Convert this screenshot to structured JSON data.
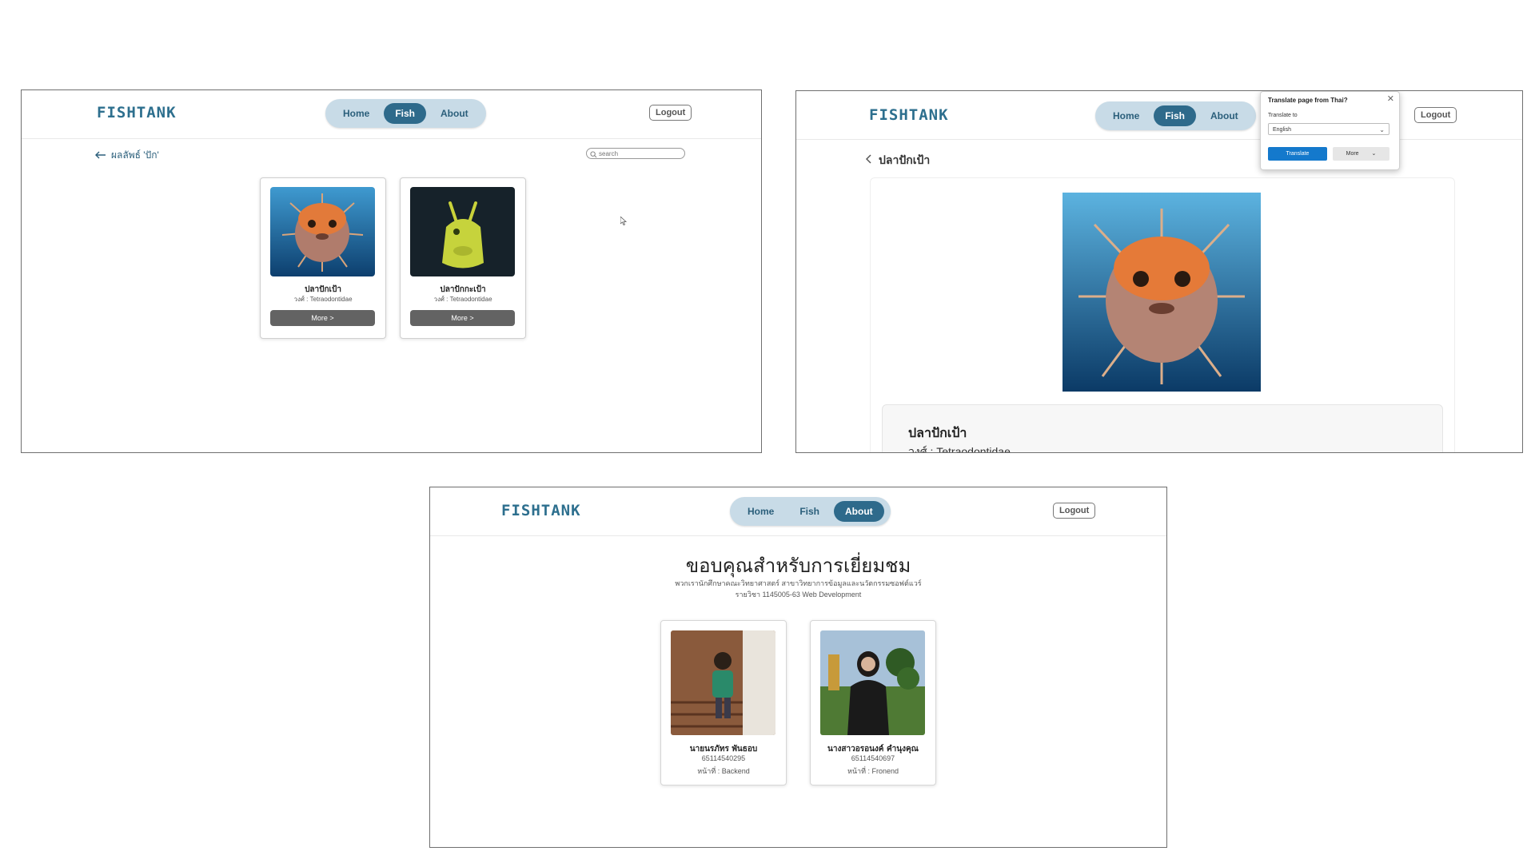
{
  "app": {
    "logo": "FISHTANK",
    "logout_label": "Logout"
  },
  "nav": {
    "home": "Home",
    "fish": "Fish",
    "about": "About"
  },
  "list_view": {
    "breadcrumb": "ผลลัพธ์ 'ปัก'",
    "search_placeholder": "search",
    "cards": [
      {
        "name": "ปลาปักเป้า",
        "family": "วงศ์ : Tetraodontidae",
        "button": "More >"
      },
      {
        "name": "ปลาปักกะเป้า",
        "family": "วงศ์ : Tetraodontidae",
        "button": "More >"
      }
    ]
  },
  "detail_view": {
    "title": "ปลาปักเป้า",
    "name": "ปลาปักเป้า",
    "family": "วงศ์ : Tetraodontidae",
    "translate_popup": {
      "title": "Translate page from Thai?",
      "label": "Translate to",
      "language": "English",
      "translate_button": "Translate",
      "more_button": "More"
    }
  },
  "about_view": {
    "heading": "ขอบคุณสำหรับการเยี่ยมชม",
    "subtitle1": "พวกเรานักศึกษาคณะวิทยาศาสตร์ สาขาวิทยาการข้อมูลและนวัตกรรมซอฟต์แวร์",
    "subtitle2": "รายวิชา 1145005-63 Web Development",
    "members": [
      {
        "name": "นายนรภัทร พันธอบ",
        "id": "65114540295",
        "role": "หน้าที่ : Backend"
      },
      {
        "name": "นางสาวอรอนงค์ คำนุงคุณ",
        "id": "65114540697",
        "role": "หน้าที่ : Fronend"
      }
    ]
  }
}
